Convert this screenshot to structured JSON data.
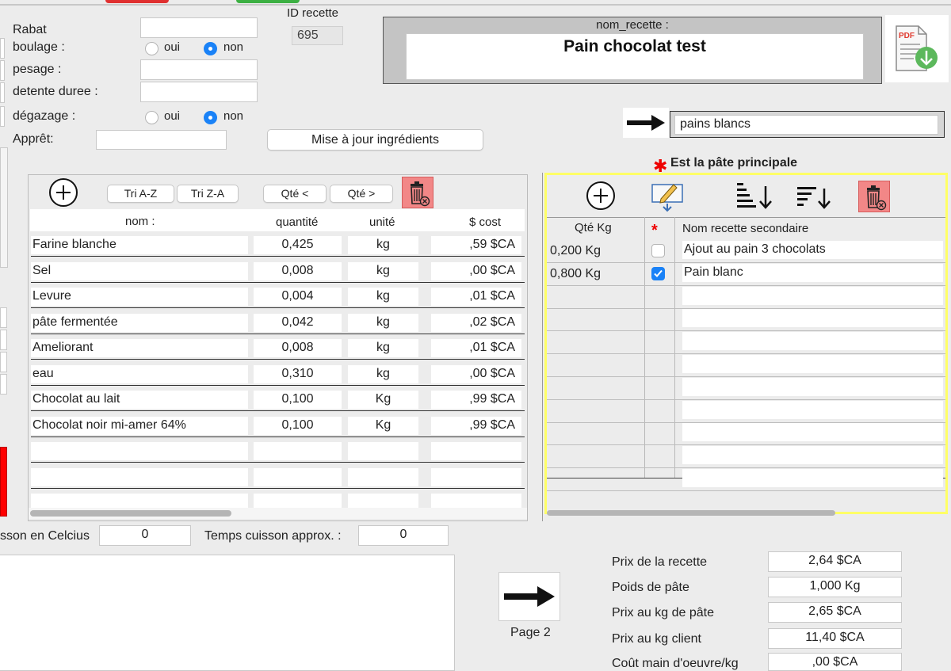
{
  "colors": {
    "accent": "#1a82f7",
    "highlight": "#ffff66",
    "trash": "#f28787",
    "red_bar": "#ff0000"
  },
  "form": {
    "rabat_label": "Rabat",
    "boulage_label": "boulage :",
    "pesage_label": "pesage :",
    "detente_label": "detente duree :",
    "degazage_label": "dégazage :",
    "appret_label": "Apprêt:",
    "oui": "oui",
    "non": "non",
    "update_button": "Mise à jour ingrédients"
  },
  "recipe": {
    "id_label": "ID recette",
    "id_value": "695",
    "name_label": "nom_recette :",
    "name_value": "Pain chocolat test",
    "category_value": "pains blancs",
    "main_dough_note": "Est la pâte principale"
  },
  "ingredients": {
    "buttons": {
      "sort_az": "Tri A-Z",
      "sort_za": "Tri Z-A",
      "qty_less": "Qté  <",
      "qty_more": "Qté  >"
    },
    "headers": {
      "nom": "nom :",
      "quantite": "quantité",
      "unite": "unité",
      "cost": "$ cost"
    },
    "rows": [
      {
        "nom": "Farine blanche",
        "quantite": "0,425",
        "unite": "kg",
        "cost": ",59 $CA"
      },
      {
        "nom": "Sel",
        "quantite": "0,008",
        "unite": "kg",
        "cost": ",00 $CA"
      },
      {
        "nom": "Levure",
        "quantite": "0,004",
        "unite": "kg",
        "cost": ",01 $CA"
      },
      {
        "nom": "pâte fermentée",
        "quantite": "0,042",
        "unite": "kg",
        "cost": ",02 $CA"
      },
      {
        "nom": "Ameliorant",
        "quantite": "0,008",
        "unite": "kg",
        "cost": ",01 $CA"
      },
      {
        "nom": "eau",
        "quantite": "0,310",
        "unite": "kg",
        "cost": ",00 $CA"
      },
      {
        "nom": "Chocolat au lait",
        "quantite": "0,100",
        "unite": "Kg",
        "cost": ",99 $CA"
      },
      {
        "nom": "Chocolat noir mi-amer 64%",
        "quantite": "0,100",
        "unite": "Kg",
        "cost": ",99 $CA"
      }
    ]
  },
  "secondary": {
    "headers": {
      "qty": "Qté Kg",
      "star": "*",
      "name": "Nom recette secondaire"
    },
    "rows": [
      {
        "qty": "0,200 Kg",
        "checked": false,
        "name": "Ajout au pain 3 chocolats"
      },
      {
        "qty": "0,800 Kg",
        "checked": true,
        "name": "Pain blanc"
      }
    ]
  },
  "cuisson": {
    "temp_label": "sson en Celcius",
    "temp_value": "0",
    "time_label": "Temps cuisson approx. :",
    "time_value": "0"
  },
  "totals": {
    "page2_label": "Page 2",
    "prix_recette_label": "Prix de la recette",
    "prix_recette": "2,64 $CA",
    "poids_label": "Poids de pâte",
    "poids": "1,000 Kg",
    "prix_kg_label": "Prix au kg de pâte",
    "prix_kg": "2,65 $CA",
    "prix_client_label": "Prix au kg client",
    "prix_client": "11,40 $CA",
    "main_oeuvre_label": "Coût main d'oeuvre/kg",
    "main_oeuvre": ",00 $CA"
  }
}
